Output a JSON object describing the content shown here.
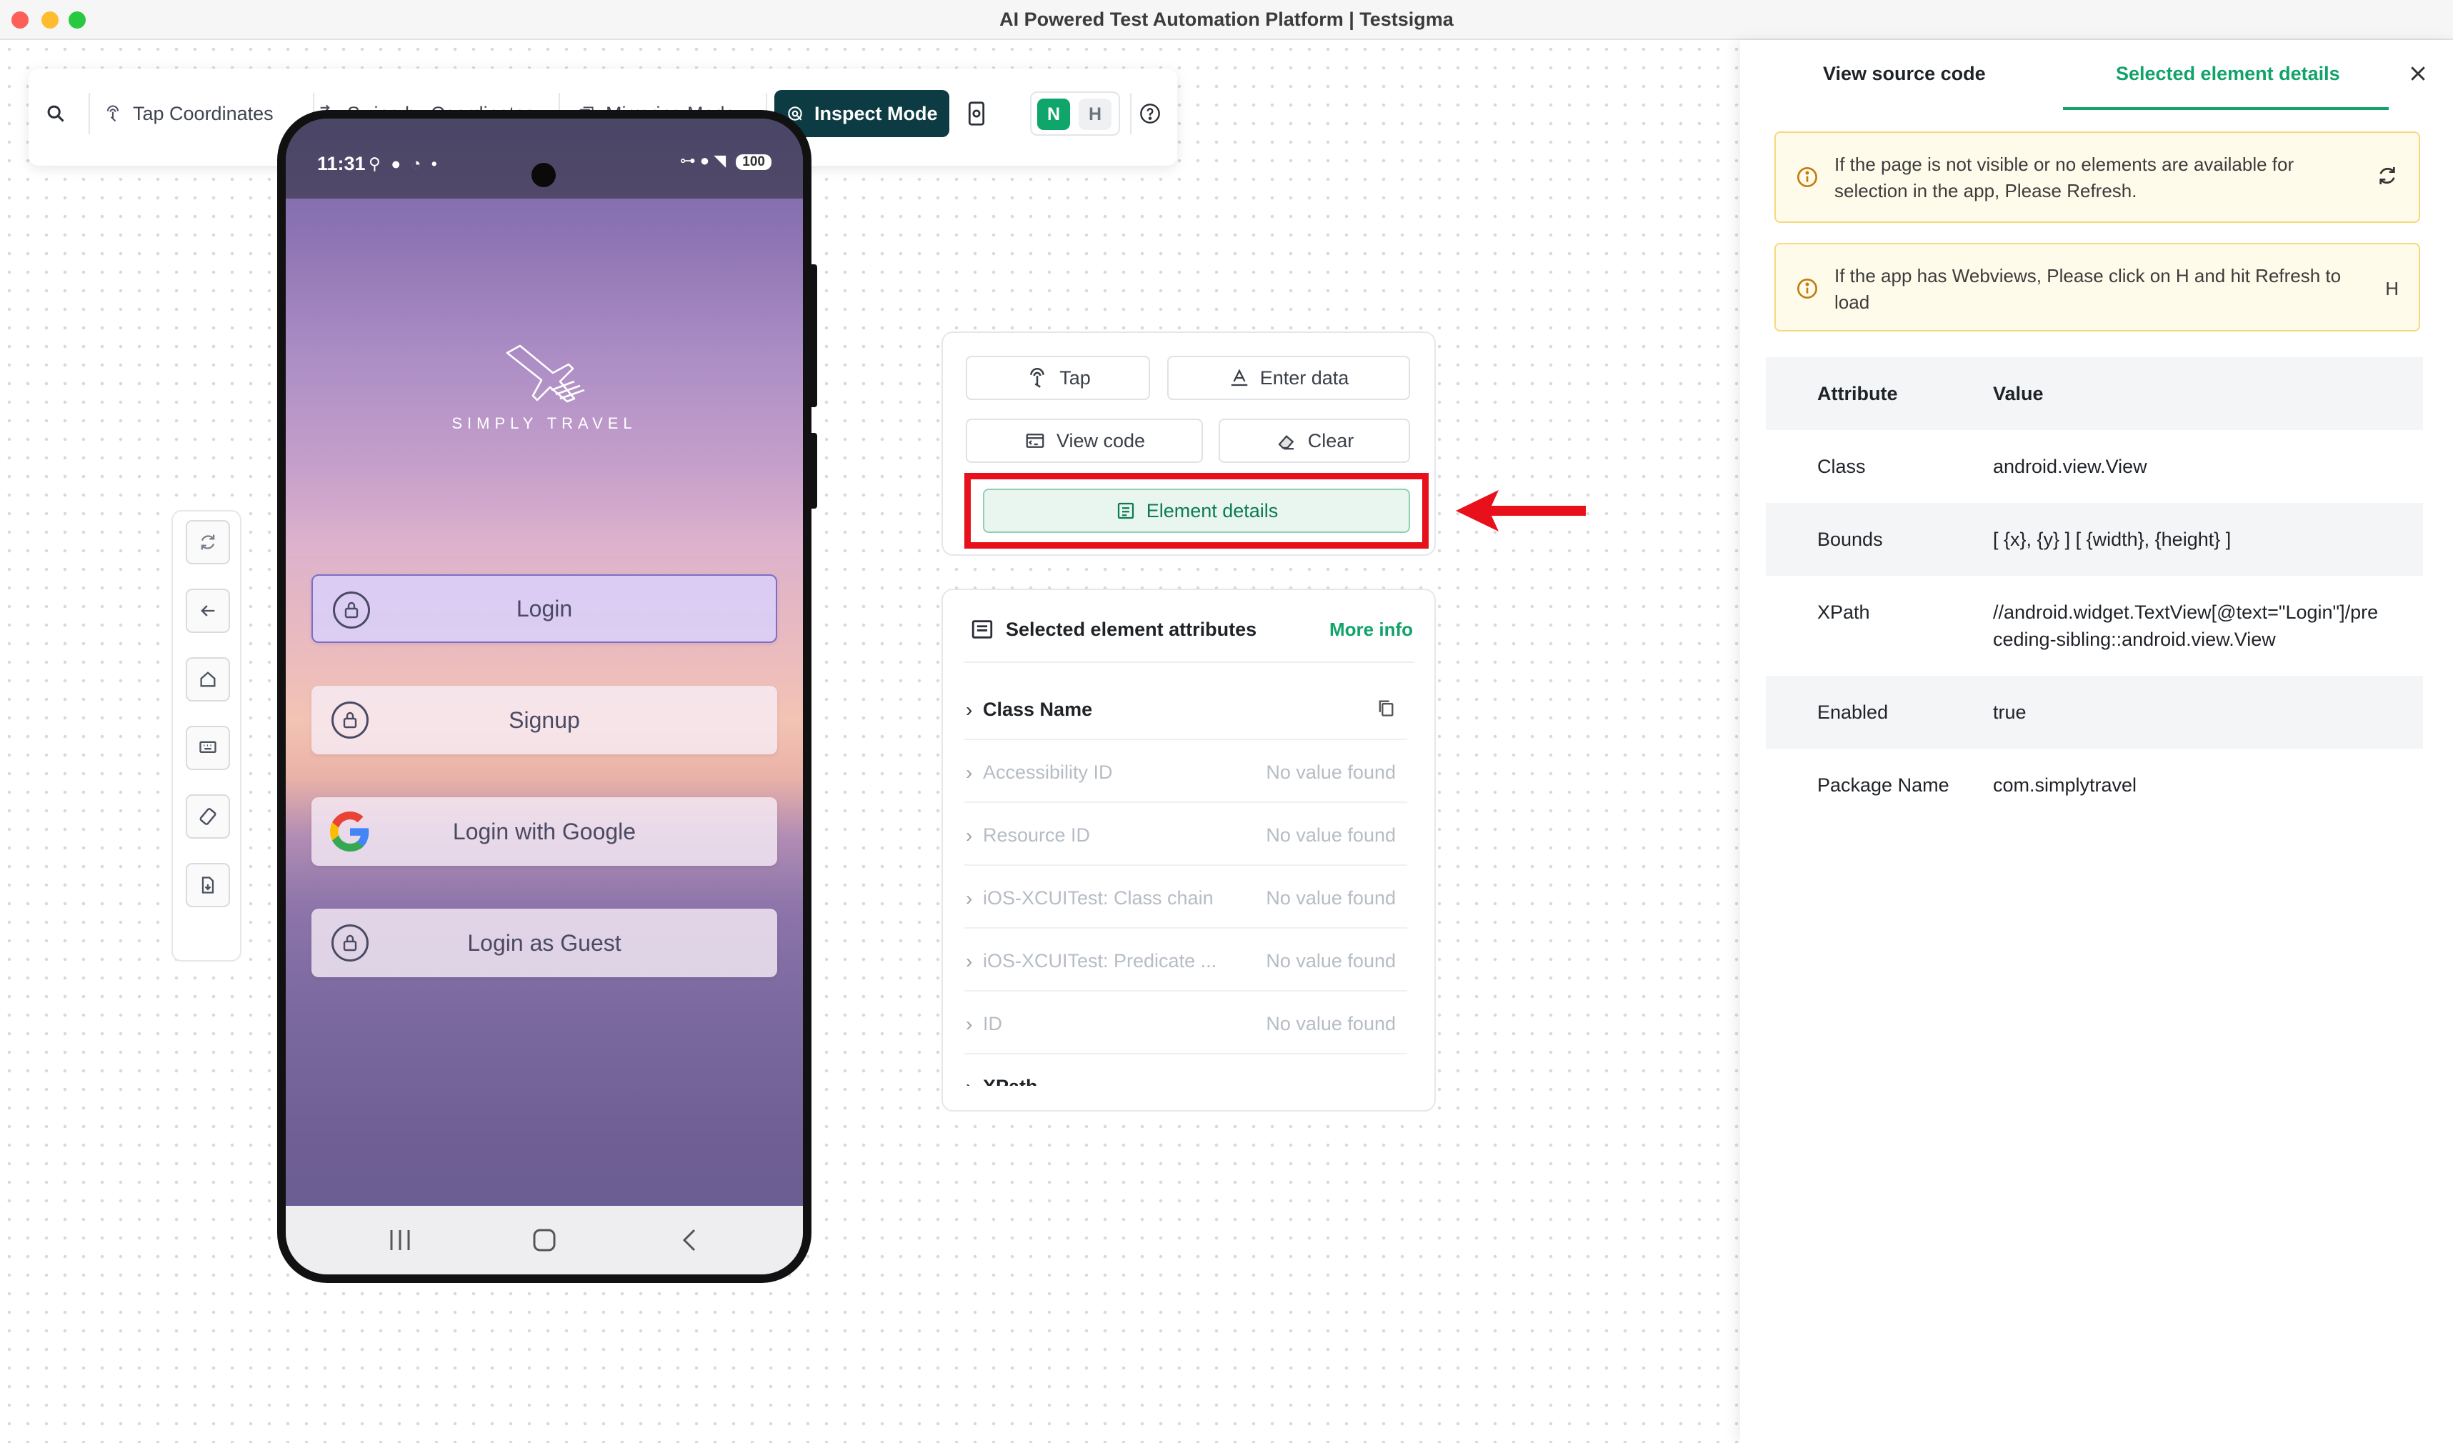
{
  "window": {
    "title": "AI Powered Test Automation Platform | Testsigma"
  },
  "toolbar": {
    "tap_coordinates": "Tap Coordinates",
    "swipe_by_coordinates": "Swipe by Coordinates",
    "mirroring_mode": "Mirroring Mode",
    "inspect_mode": "Inspect Mode",
    "native_label": "N",
    "hybrid_label": "H",
    "accent_color": "#0c3b43",
    "native_color": "#10a56b"
  },
  "side_tools": [
    "refresh-icon",
    "back-icon",
    "home-icon",
    "keyboard-icon",
    "rotate-icon",
    "install-app-icon"
  ],
  "device": {
    "status_time": "11:31",
    "battery": "100",
    "brand_text": "SIMPLY TRAVEL",
    "buttons": {
      "login": "Login",
      "signup": "Signup",
      "login_google": "Login with Google",
      "login_guest": "Login as Guest"
    }
  },
  "actions": {
    "tap": "Tap",
    "enter_data": "Enter data",
    "view_code": "View code",
    "clear": "Clear",
    "element_details": "Element details"
  },
  "attributes_panel": {
    "title": "Selected element attributes",
    "more_info": "More info",
    "items": [
      {
        "name": "Class Name",
        "value": ""
      },
      {
        "name": "Accessibility ID",
        "value": "No value found"
      },
      {
        "name": "Resource ID",
        "value": "No value found"
      },
      {
        "name": "iOS-XCUITest: Class chain",
        "value": "No value found"
      },
      {
        "name": "iOS-XCUITest: Predicate ...",
        "value": "No value found"
      },
      {
        "name": "ID",
        "value": "No value found"
      },
      {
        "name": "XPath",
        "value": ""
      }
    ]
  },
  "right_panel": {
    "tab_source": "View source code",
    "tab_details": "Selected element details",
    "notice_refresh": "If the page is not visible or no elements are available for selection in the app, Please Refresh.",
    "notice_webview": "If the app has Webviews, Please click on H and hit Refresh to load",
    "notice_webview_action": "H",
    "table_header": {
      "attribute": "Attribute",
      "value": "Value"
    },
    "rows": [
      {
        "attribute": "Class",
        "value": "android.view.View"
      },
      {
        "attribute": "Bounds",
        "value": "[ {x}, {y} ] [ {width}, {height} ]"
      },
      {
        "attribute": "XPath",
        "value": "//android.widget.TextView[@text=\"Login\"]/preceding-sibling::android.view.View"
      },
      {
        "attribute": "Enabled",
        "value": "true"
      },
      {
        "attribute": "Package Name",
        "value": "com.simplytravel"
      }
    ],
    "active_tab_color": "#12a36a",
    "notice_bg": "#fffbeb"
  },
  "annotation": {
    "highlight_color": "#e8101a"
  }
}
